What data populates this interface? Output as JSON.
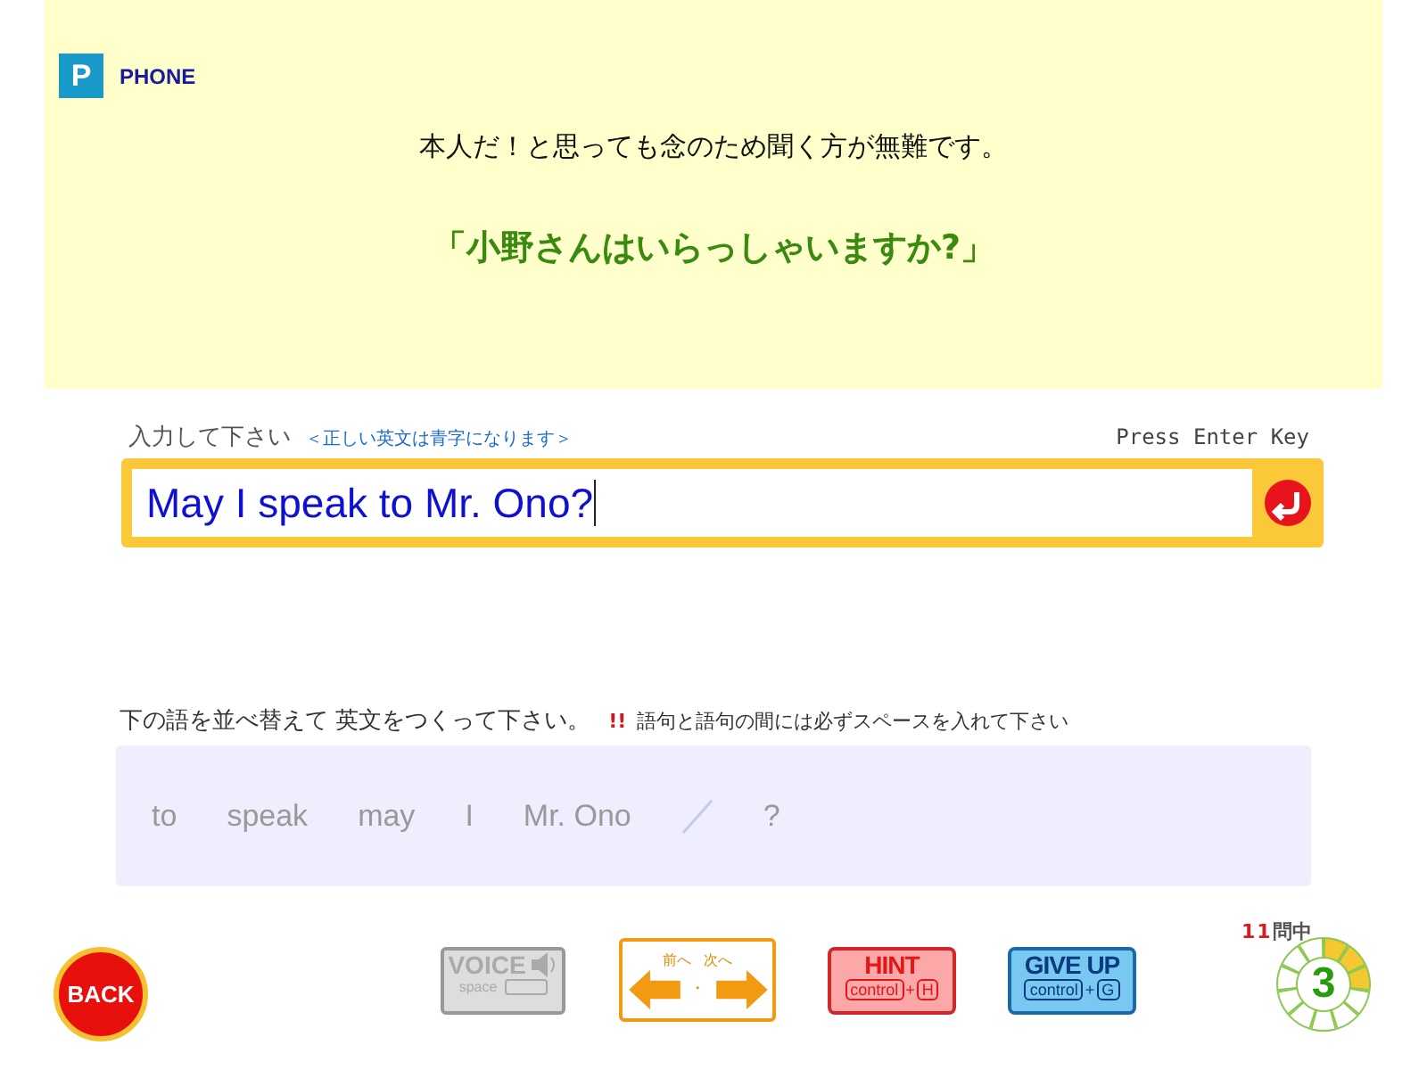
{
  "category": {
    "letter": "P",
    "label": "PHONE"
  },
  "instruction": "本人だ！と思っても念のため聞く方が無難です。",
  "prompt": "「小野さんはいらっしゃいますか?」",
  "answer": {
    "label": "入力して下さい",
    "hint": "＜正しい英文は青字になります＞",
    "press_key": "Press Enter Key",
    "value": "May I speak to Mr. Ono?",
    "correct": true
  },
  "words_section": {
    "label": "下の語を並べ替えて 英文をつくって下さい。",
    "warning_mark": "!!",
    "warning": "語句と語句の間には必ずスペースを入れて下さい",
    "words": [
      {
        "text": "to",
        "kind": "word"
      },
      {
        "text": "speak",
        "kind": "word"
      },
      {
        "text": "may",
        "kind": "word"
      },
      {
        "text": "I",
        "kind": "word"
      },
      {
        "text": "Mr. Ono",
        "kind": "word"
      },
      {
        "kind": "slash"
      },
      {
        "text": "?",
        "kind": "word"
      }
    ]
  },
  "buttons": {
    "back": "BACK",
    "voice": {
      "label": "VOICE",
      "key": "space",
      "disabled": true
    },
    "nav": {
      "prev": "前へ",
      "separator": "・",
      "next": "次へ"
    },
    "hint": {
      "label": "HINT",
      "modifier": "control",
      "plus": "+",
      "key": "H"
    },
    "give_up": {
      "label": "GIVE UP",
      "modifier": "control",
      "plus": "+",
      "key": "G"
    }
  },
  "progress": {
    "total": "11",
    "suffix": "問中",
    "current": "3",
    "level": 0.2727
  }
}
